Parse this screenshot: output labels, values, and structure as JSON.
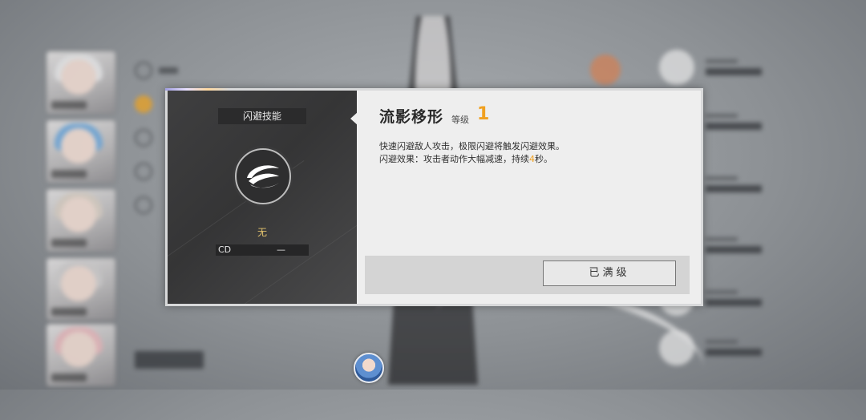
{
  "dialog": {
    "category_label": "闪避技能",
    "skill_icon": "dodge-swirl-icon",
    "requirement_text": "无",
    "cd_label": "CD",
    "cd_value": "—",
    "skill_name": "流影移形",
    "level_label": "等级",
    "level_value": "1",
    "desc_line1": "快速闪避敌人攻击，极限闪避将触发闪避效果。",
    "desc_line2_prefix": "闪避效果：攻击者动作大幅减速，持续",
    "desc_line2_highlight": "4",
    "desc_line2_suffix": "秒。",
    "max_button_label": "已满级"
  },
  "colors": {
    "accent": "#f0a020",
    "panel_dark": "#3b3b3c",
    "panel_light": "#eeeeee"
  }
}
